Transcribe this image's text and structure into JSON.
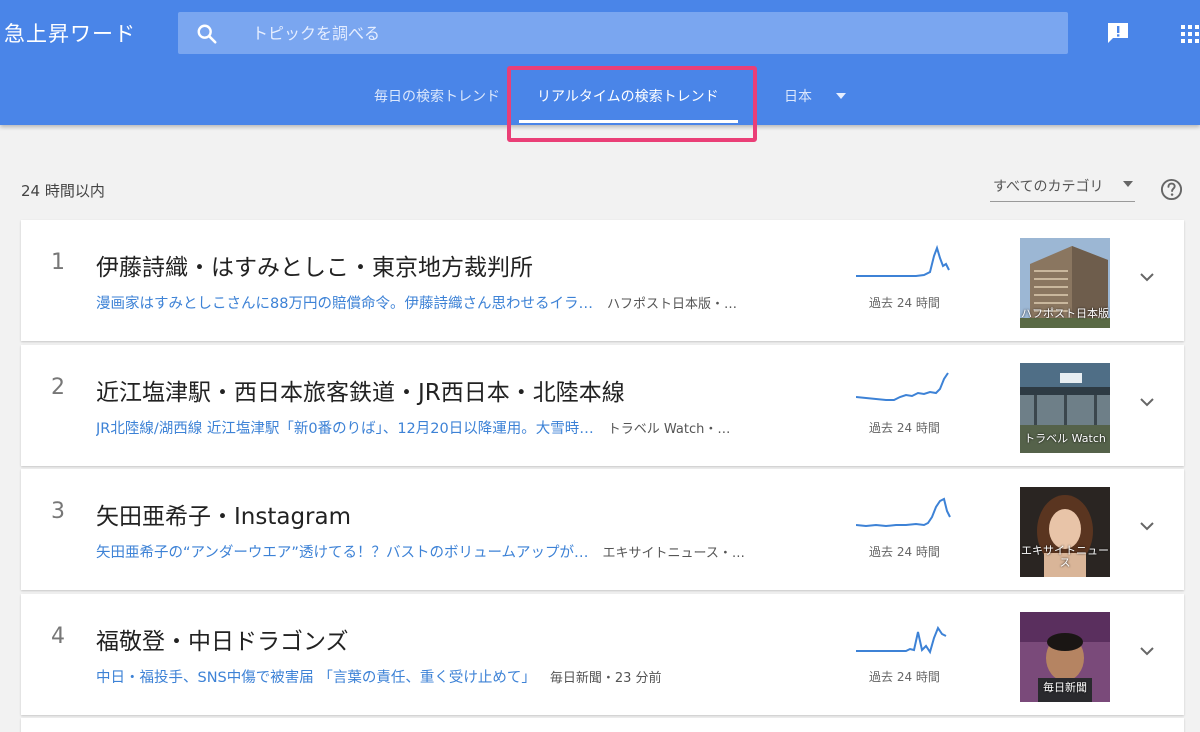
{
  "app": {
    "title": "急上昇ワード"
  },
  "search": {
    "placeholder": "トピックを調べる"
  },
  "tabs": [
    {
      "label": "毎日の検索トレンド"
    },
    {
      "label": "リアルタイムの検索トレンド"
    }
  ],
  "country": {
    "label": "日本"
  },
  "filters": {
    "period": "24 時間以内",
    "category": "すべてのカテゴリ"
  },
  "colors": {
    "header": "#4a85e8",
    "highlight": "#ea3f77",
    "link": "#3d82d6",
    "spark": "#3d82d6"
  },
  "trends": [
    {
      "rank": "1",
      "title": "伊藤詩織・はすみとしこ・東京地方裁判所",
      "headline": "漫画家はすみとしこさんに88万円の賠償命令。伊藤詩織さん思わせるイラ…",
      "source": "ハフポスト日本版・…",
      "spark_caption": "過去 24 時間",
      "thumb_label": "ハフポスト日本版"
    },
    {
      "rank": "2",
      "title": "近江塩津駅・西日本旅客鉄道・JR西日本・北陸本線",
      "headline": "JR北陸線/湖西線 近江塩津駅「新0番のりば」、12月20日以降運用。大雪時…",
      "source": "トラベル Watch・…",
      "spark_caption": "過去 24 時間",
      "thumb_label": "トラベル Watch"
    },
    {
      "rank": "3",
      "title": "矢田亜希子・Instagram",
      "headline": "矢田亜希子の“アンダーウエア”透けてる！？バストのボリュームアップが…",
      "source": "エキサイトニュース・…",
      "spark_caption": "過去 24 時間",
      "thumb_label": "エキサイトニュース"
    },
    {
      "rank": "4",
      "title": "福敬登・中日ドラゴンズ",
      "headline": "中日・福投手、SNS中傷で被害届 「言葉の責任、重く受け止めて」",
      "source": "毎日新聞・23 分前",
      "spark_caption": "過去 24 時間",
      "thumb_label": "毎日新聞"
    }
  ]
}
